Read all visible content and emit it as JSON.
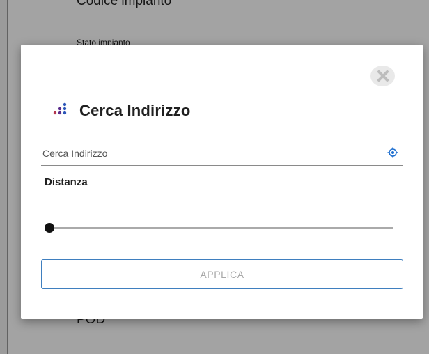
{
  "background": {
    "field_top_title": "Codice impianto",
    "status_label": "Stato impianto",
    "field_bottom_title": "POD"
  },
  "dialog": {
    "close_icon": "close-x-icon",
    "title_icon": "dots-logo-icon",
    "title": "Cerca Indirizzo",
    "search": {
      "placeholder": "Cerca Indirizzo",
      "value": ""
    },
    "locate_icon": "crosshair-location-icon",
    "distance_label": "Distanza",
    "slider": {
      "value": 0,
      "min": 0,
      "max": 100
    },
    "apply_label": "APPLICA"
  },
  "colors": {
    "accent": "#3f7fbf",
    "logo_purple": "#5a2d8c",
    "logo_blue": "#2c56b8",
    "logo_red": "#b3364f"
  }
}
